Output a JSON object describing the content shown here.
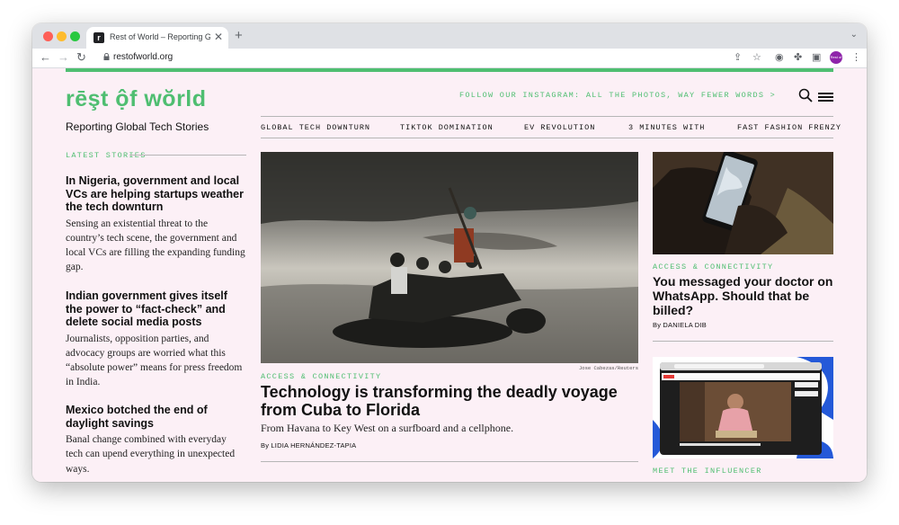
{
  "browser": {
    "tab_title": "Rest of World – Reporting Global Tech Stories",
    "tab_favicon": "r",
    "url": "restofworld.org",
    "profile_label": "Rest of World",
    "icons": [
      "back-icon",
      "forward-icon",
      "reload-icon",
      "lock-icon",
      "share-icon",
      "star-icon",
      "password-icon",
      "extensions-icon",
      "sidepanel-icon",
      "kebab-menu-icon"
    ]
  },
  "site": {
    "logo": "rēşt ộf wŏrld",
    "tagline": "Reporting Global Tech Stories",
    "instagram": "FOLLOW OUR INSTAGRAM: ALL THE PHOTOS, WAY FEWER WORDS >",
    "accent_color": "#4fbe71",
    "topics": [
      "GLOBAL TECH DOWNTURN",
      "TIKTOK DOMINATION",
      "EV REVOLUTION",
      "3 MINUTES WITH",
      "FAST FASHION FRENZY"
    ]
  },
  "latest": {
    "label": "LATEST STORIES",
    "stories": [
      {
        "headline": "In Nigeria, government and local VCs are helping startups weather the tech downturn",
        "dek": "Sensing an existential threat to the country’s tech scene, the government and local VCs are filling the expanding funding gap."
      },
      {
        "headline": "Indian government gives itself the power to “fact-check” and delete social media posts",
        "dek": "Journalists, opposition parties, and advocacy groups are worried what this “absolute power” means for press freedom in India."
      },
      {
        "headline": "Mexico botched the end of daylight savings",
        "dek": "Banal change combined with everyday tech can upend everything in unexpected ways."
      }
    ]
  },
  "main": {
    "image_credit": "Jose Cabezas/Reuters",
    "kicker": "ACCESS & CONNECTIVITY",
    "headline": "Technology is transforming the deadly voyage from Cuba to Florida",
    "dek": "From Havana to Key West on a surfboard and a cellphone.",
    "byline": "By LIDIA HERNÁNDEZ-TAPIA"
  },
  "side": {
    "story1": {
      "kicker": "ACCESS & CONNECTIVITY",
      "headline": "You messaged your doctor on WhatsApp. Should that be billed?",
      "byline": "By DANIELA DIB"
    },
    "story2": {
      "kicker": "MEET THE INFLUENCER"
    }
  }
}
